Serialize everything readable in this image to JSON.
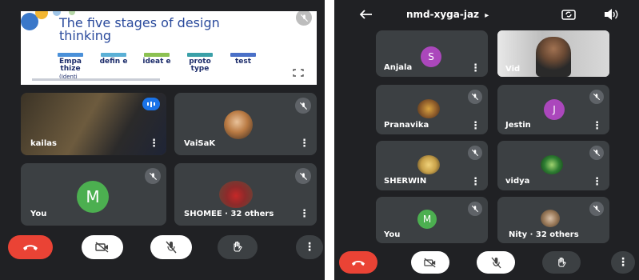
{
  "left_screen": {
    "slide": {
      "title": "The five stages of design thinking",
      "stages": [
        {
          "label": "Empa thize",
          "bar_color": "#4a90d9"
        },
        {
          "label": "defin e",
          "bar_color": "#5bb0d6"
        },
        {
          "label": "ideat e",
          "bar_color": "#8cc152"
        },
        {
          "label": "proto type",
          "bar_color": "#3aa0a8"
        },
        {
          "label": "test",
          "bar_color": "#4a70c8"
        }
      ],
      "sub_label": "(Identi"
    },
    "tiles": [
      {
        "name": "kailas"
      },
      {
        "name": "VaiSaK"
      },
      {
        "name": "You",
        "initial": "M",
        "avatar_color": "#4caf50"
      },
      {
        "name": "SHOMEE · 32 others"
      }
    ]
  },
  "right_screen": {
    "meeting_code": "nmd-xyga-jaz",
    "code_arrow": "▸",
    "tiles": [
      {
        "name": "Anjala",
        "initial": "S",
        "avatar_color": "#ab47bc"
      },
      {
        "name": "Vid"
      },
      {
        "name": "Pranavika"
      },
      {
        "name": "Jestin",
        "initial": "J",
        "avatar_color": "#ab47bc"
      },
      {
        "name": "SHERWIN"
      },
      {
        "name": "vidya"
      },
      {
        "name": "You",
        "initial": "M",
        "avatar_color": "#4caf50"
      },
      {
        "name": "Nity · 32 others"
      }
    ]
  },
  "controls": {
    "end_call_color": "#ea4335",
    "more_glyph": "⋮",
    "kebab_glyph": "⋮"
  },
  "icons": [
    "end-call-icon",
    "camera-off-icon",
    "mic-off-icon",
    "raise-hand-icon",
    "more-options-icon",
    "back-arrow-icon",
    "switch-camera-icon",
    "speaker-icon",
    "fullscreen-icon",
    "sound-level-icon"
  ]
}
